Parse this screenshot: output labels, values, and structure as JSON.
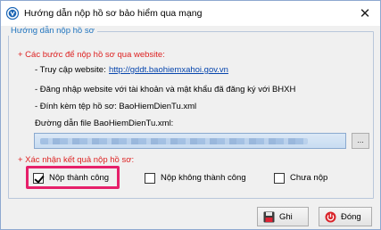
{
  "window": {
    "title": "Hướng dẫn nộp hồ sơ bảo hiểm qua mạng",
    "close_glyph": "✕"
  },
  "group": {
    "title": "Hướng dẫn nộp hồ sơ"
  },
  "section_steps": {
    "heading": "+ Các bước để nộp hồ sơ qua website:",
    "step1_label": "- Truy cập website:",
    "step1_link": "http://gddt.baohiemxahoi.gov.vn",
    "step2": "- Đăng nhập website với tài khoản và mật khẩu đã đăng ký với BHXH",
    "step3": "- Đính kèm tệp hồ sơ: BaoHiemDienTu.xml",
    "step4": "Đường dẫn file BaoHiemDienTu.xml:",
    "browse_label": "..."
  },
  "section_result": {
    "heading": "+ Xác nhận kết quả nộp hồ sơ:",
    "options": [
      {
        "label": "Nộp thành công",
        "checked": true
      },
      {
        "label": "Nộp không thành công",
        "checked": false
      },
      {
        "label": "Chưa nộp",
        "checked": false
      }
    ]
  },
  "buttons": {
    "save": "Ghi",
    "close": "Đóng"
  },
  "colors": {
    "accent_blue": "#1e73be",
    "red_text": "#dd2222",
    "highlight": "#e6206a"
  },
  "icons": {
    "app": "bhxh-logo-icon",
    "save": "floppy-disk-icon",
    "close": "power-icon"
  }
}
